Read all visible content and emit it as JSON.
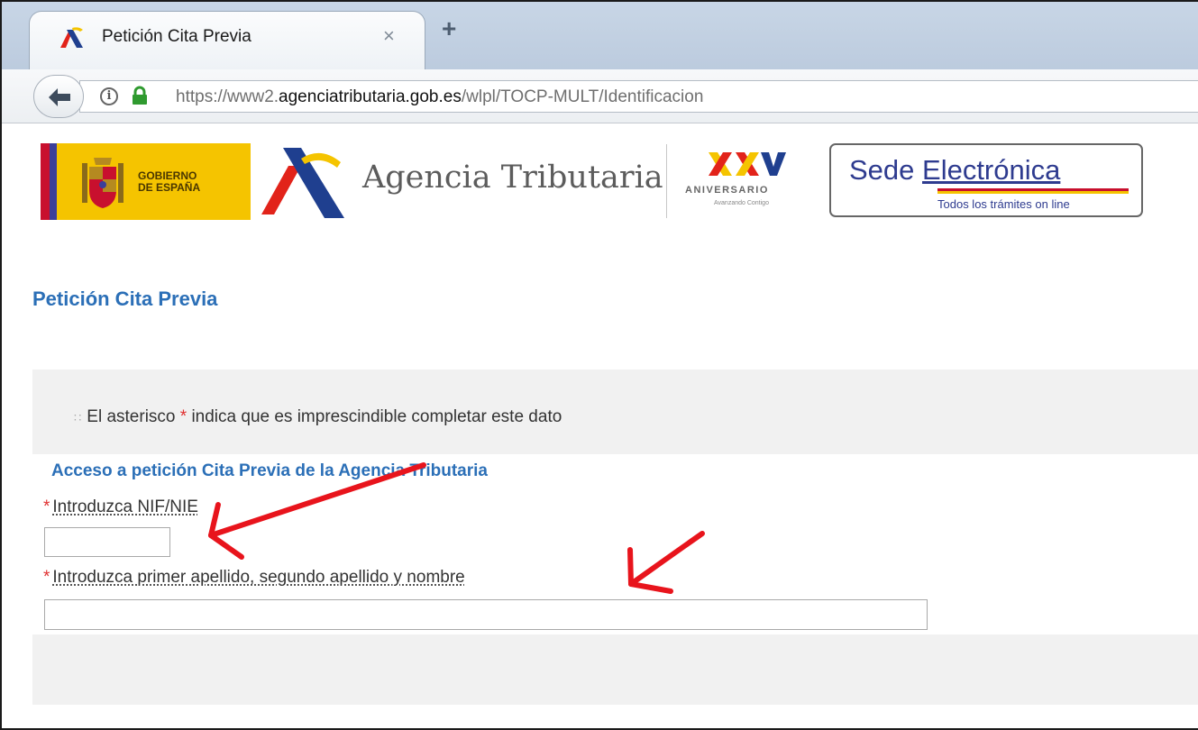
{
  "browser": {
    "tab_title": "Petición Cita Previa",
    "tab_close": "×",
    "new_tab": "+",
    "url_prefix": "https://www2.",
    "url_domain": "agenciatributaria.gob.es",
    "url_path": "/wlpl/TOCP-MULT/Identificacion",
    "info_glyph": "i"
  },
  "header": {
    "gov_text": "GOBIERNO\nDE ESPAÑA",
    "agency_name": "Agencia Tributaria",
    "anniversary_mark": "XXV",
    "anniversary_word": "ANIVERSARIO",
    "anniversary_tagline": "Avanzando Contigo",
    "sede_word1": "Sede ",
    "sede_word2": "Electrónica",
    "sede_subtitle": "Todos los trámites on line"
  },
  "page": {
    "title": "Petición Cita Previa"
  },
  "form": {
    "note_prefix": "El asterisco ",
    "note_star": "*",
    "note_suffix": " indica que es imprescindible completar este dato",
    "section_title": "Acceso a petición Cita Previa de la Agencia Tributaria",
    "required_star": "*",
    "nif_label": "Introduzca NIF/NIE",
    "nif_value": "",
    "name_label": "Introduzca primer apellido, segundo apellido y nombre",
    "name_value": ""
  },
  "colors": {
    "link_blue": "#2b6fb7",
    "required_red": "#e03030",
    "annotation_red": "#e8141c",
    "gov_yellow": "#f5c400"
  },
  "icons": [
    "favicon-icon",
    "close-icon",
    "plus-icon",
    "back-arrow-icon",
    "info-icon",
    "lock-icon",
    "bullet-icon",
    "annotation-arrow-icon"
  ]
}
